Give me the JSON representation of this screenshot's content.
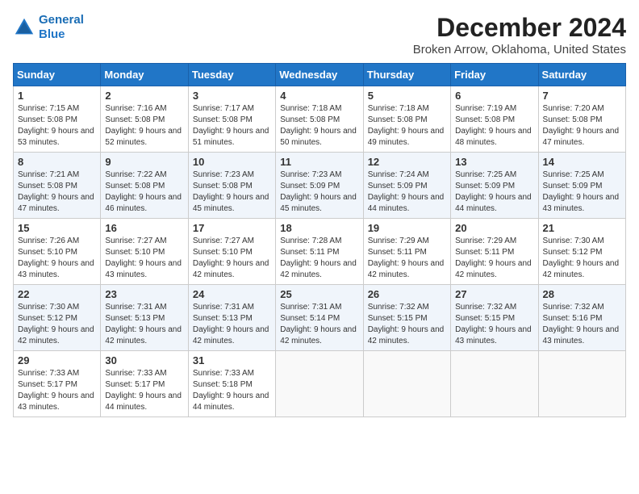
{
  "header": {
    "logo_line1": "General",
    "logo_line2": "Blue",
    "month": "December 2024",
    "location": "Broken Arrow, Oklahoma, United States"
  },
  "weekdays": [
    "Sunday",
    "Monday",
    "Tuesday",
    "Wednesday",
    "Thursday",
    "Friday",
    "Saturday"
  ],
  "weeks": [
    [
      {
        "day": "1",
        "sunrise": "7:15 AM",
        "sunset": "5:08 PM",
        "daylight": "9 hours and 53 minutes."
      },
      {
        "day": "2",
        "sunrise": "7:16 AM",
        "sunset": "5:08 PM",
        "daylight": "9 hours and 52 minutes."
      },
      {
        "day": "3",
        "sunrise": "7:17 AM",
        "sunset": "5:08 PM",
        "daylight": "9 hours and 51 minutes."
      },
      {
        "day": "4",
        "sunrise": "7:18 AM",
        "sunset": "5:08 PM",
        "daylight": "9 hours and 50 minutes."
      },
      {
        "day": "5",
        "sunrise": "7:18 AM",
        "sunset": "5:08 PM",
        "daylight": "9 hours and 49 minutes."
      },
      {
        "day": "6",
        "sunrise": "7:19 AM",
        "sunset": "5:08 PM",
        "daylight": "9 hours and 48 minutes."
      },
      {
        "day": "7",
        "sunrise": "7:20 AM",
        "sunset": "5:08 PM",
        "daylight": "9 hours and 47 minutes."
      }
    ],
    [
      {
        "day": "8",
        "sunrise": "7:21 AM",
        "sunset": "5:08 PM",
        "daylight": "9 hours and 47 minutes."
      },
      {
        "day": "9",
        "sunrise": "7:22 AM",
        "sunset": "5:08 PM",
        "daylight": "9 hours and 46 minutes."
      },
      {
        "day": "10",
        "sunrise": "7:23 AM",
        "sunset": "5:08 PM",
        "daylight": "9 hours and 45 minutes."
      },
      {
        "day": "11",
        "sunrise": "7:23 AM",
        "sunset": "5:09 PM",
        "daylight": "9 hours and 45 minutes."
      },
      {
        "day": "12",
        "sunrise": "7:24 AM",
        "sunset": "5:09 PM",
        "daylight": "9 hours and 44 minutes."
      },
      {
        "day": "13",
        "sunrise": "7:25 AM",
        "sunset": "5:09 PM",
        "daylight": "9 hours and 44 minutes."
      },
      {
        "day": "14",
        "sunrise": "7:25 AM",
        "sunset": "5:09 PM",
        "daylight": "9 hours and 43 minutes."
      }
    ],
    [
      {
        "day": "15",
        "sunrise": "7:26 AM",
        "sunset": "5:10 PM",
        "daylight": "9 hours and 43 minutes."
      },
      {
        "day": "16",
        "sunrise": "7:27 AM",
        "sunset": "5:10 PM",
        "daylight": "9 hours and 43 minutes."
      },
      {
        "day": "17",
        "sunrise": "7:27 AM",
        "sunset": "5:10 PM",
        "daylight": "9 hours and 42 minutes."
      },
      {
        "day": "18",
        "sunrise": "7:28 AM",
        "sunset": "5:11 PM",
        "daylight": "9 hours and 42 minutes."
      },
      {
        "day": "19",
        "sunrise": "7:29 AM",
        "sunset": "5:11 PM",
        "daylight": "9 hours and 42 minutes."
      },
      {
        "day": "20",
        "sunrise": "7:29 AM",
        "sunset": "5:11 PM",
        "daylight": "9 hours and 42 minutes."
      },
      {
        "day": "21",
        "sunrise": "7:30 AM",
        "sunset": "5:12 PM",
        "daylight": "9 hours and 42 minutes."
      }
    ],
    [
      {
        "day": "22",
        "sunrise": "7:30 AM",
        "sunset": "5:12 PM",
        "daylight": "9 hours and 42 minutes."
      },
      {
        "day": "23",
        "sunrise": "7:31 AM",
        "sunset": "5:13 PM",
        "daylight": "9 hours and 42 minutes."
      },
      {
        "day": "24",
        "sunrise": "7:31 AM",
        "sunset": "5:13 PM",
        "daylight": "9 hours and 42 minutes."
      },
      {
        "day": "25",
        "sunrise": "7:31 AM",
        "sunset": "5:14 PM",
        "daylight": "9 hours and 42 minutes."
      },
      {
        "day": "26",
        "sunrise": "7:32 AM",
        "sunset": "5:15 PM",
        "daylight": "9 hours and 42 minutes."
      },
      {
        "day": "27",
        "sunrise": "7:32 AM",
        "sunset": "5:15 PM",
        "daylight": "9 hours and 43 minutes."
      },
      {
        "day": "28",
        "sunrise": "7:32 AM",
        "sunset": "5:16 PM",
        "daylight": "9 hours and 43 minutes."
      }
    ],
    [
      {
        "day": "29",
        "sunrise": "7:33 AM",
        "sunset": "5:17 PM",
        "daylight": "9 hours and 43 minutes."
      },
      {
        "day": "30",
        "sunrise": "7:33 AM",
        "sunset": "5:17 PM",
        "daylight": "9 hours and 44 minutes."
      },
      {
        "day": "31",
        "sunrise": "7:33 AM",
        "sunset": "5:18 PM",
        "daylight": "9 hours and 44 minutes."
      },
      null,
      null,
      null,
      null
    ]
  ]
}
